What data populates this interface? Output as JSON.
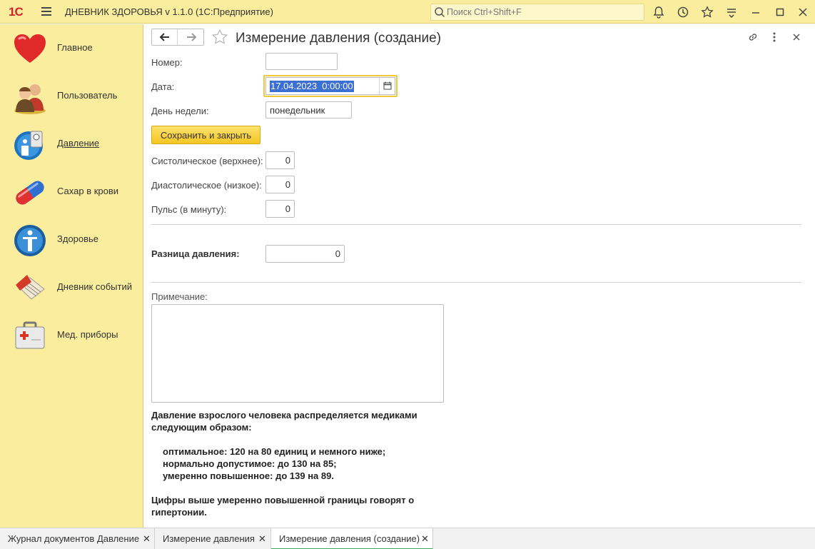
{
  "titlebar": {
    "logo": "1С",
    "title": "ДНЕВНИК ЗДОРОВЬЯ v 1.1.0  (1С:Предприятие)",
    "search_placeholder": "Поиск Ctrl+Shift+F"
  },
  "sidebar": {
    "items": [
      {
        "label": "Главное",
        "icon": "heart-icon"
      },
      {
        "label": "Пользователь",
        "icon": "users-icon"
      },
      {
        "label": "Давление",
        "icon": "blood-pressure-icon"
      },
      {
        "label": "Сахар в крови",
        "icon": "pill-icon"
      },
      {
        "label": "Здоровье",
        "icon": "person-icon"
      },
      {
        "label": "Дневник событий",
        "icon": "diary-icon"
      },
      {
        "label": "Мед. приборы",
        "icon": "first-aid-kit-icon"
      }
    ],
    "active_index": 2
  },
  "form": {
    "title": "Измерение давления (создание)",
    "number_label": "Номер:",
    "number_value": "",
    "date_label": "Дата:",
    "date_value": "17.04.2023  0:00:00",
    "weekday_label": "День недели:",
    "weekday_value": "понедельник",
    "save_button": "Сохранить и закрыть",
    "systolic_label": "Систолическое (верхнее):",
    "systolic_value": "0",
    "diastolic_label": "Диастолическое (низкое):",
    "diastolic_value": "0",
    "pulse_label": "Пульс (в минуту):",
    "pulse_value": "0",
    "diff_label": "Разница давления:",
    "diff_value": "0",
    "note_label": "Примечание:",
    "note_value": ""
  },
  "info": {
    "line1": "Давление взрослого человека распределяется медиками",
    "line2": "следующим образом:",
    "item1": "оптимальное: 120 на 80 единиц и немного ниже;",
    "item2": "нормально допустимое: до 130 на 85;",
    "item3": "умеренно повышенное: до 139 на 89.",
    "line3": "Цифры выше умеренно повышенной границы говорят о",
    "line4": "гипертонии."
  },
  "tabs": [
    {
      "label": "Журнал документов Давление",
      "active": false
    },
    {
      "label": "Измерение давления",
      "active": false
    },
    {
      "label": "Измерение давления (создание)",
      "active": true
    }
  ],
  "colors": {
    "panel_bg": "#fbed9e",
    "save_button": "#f3c623",
    "date_focus_border": "#f0c93a",
    "active_tab_underline": "#3aa75b"
  }
}
